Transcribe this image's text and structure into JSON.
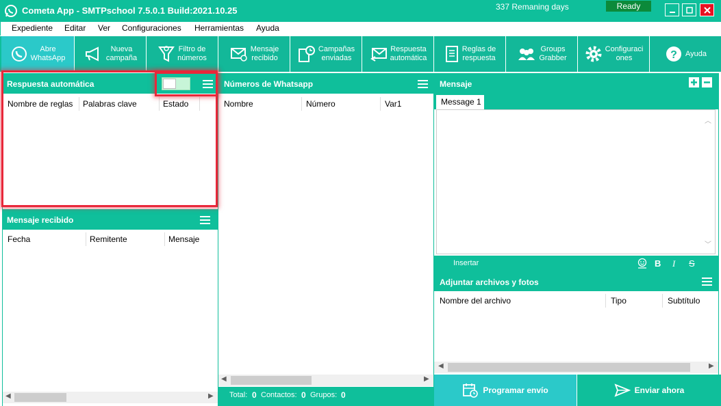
{
  "titlebar": {
    "title": "Cometa App - SMTPschool 7.5.0.1 Build:2021.10.25",
    "remaining": "337 Remaning days",
    "status": "Ready"
  },
  "menu": [
    "Expediente",
    "Editar",
    "Ver",
    "Configuraciones",
    "Herramientas",
    "Ayuda"
  ],
  "toolbar": [
    {
      "label": "Abre\nWhatsApp",
      "icon": "whatsapp-icon"
    },
    {
      "label": "Nueva\ncampaña",
      "icon": "megaphone-icon"
    },
    {
      "label": "Filtro de\nnúmeros",
      "icon": "funnel-icon"
    },
    {
      "label": "Mensaje\nrecibido",
      "icon": "envelope-check-icon"
    },
    {
      "label": "Campañas\nenviadas",
      "icon": "clock-list-icon"
    },
    {
      "label": "Respuesta\nautomática",
      "icon": "envelope-reply-icon"
    },
    {
      "label": "Reglas de\nrespuesta",
      "icon": "document-icon"
    },
    {
      "label": "Groups\nGrabber",
      "icon": "group-icon"
    },
    {
      "label": "Configuraci\nones",
      "icon": "gear-icon"
    },
    {
      "label": "Ayuda",
      "icon": "help-icon"
    }
  ],
  "auto_reply": {
    "title": "Respuesta automática",
    "toggle_on": true,
    "columns": [
      "Nombre de reglas",
      "Palabras clave",
      "Estado"
    ]
  },
  "received": {
    "title": "Mensaje recibido",
    "columns": [
      "Fecha",
      "Remitente",
      "Mensaje"
    ]
  },
  "numbers": {
    "title": "Números de Whatsapp",
    "columns": [
      "Nombre",
      "Número",
      "Var1"
    ],
    "footer": {
      "total_label": "Total:",
      "total": "0",
      "contacts_label": "Contactos:",
      "contacts": "0",
      "groups_label": "Grupos:",
      "groups": "0"
    }
  },
  "message": {
    "title": "Mensaje",
    "tab": "Message 1",
    "insert_label": "Insertar",
    "bold": "B",
    "italic": "I",
    "strike": "S"
  },
  "attachments": {
    "title": "Adjuntar archivos y fotos",
    "columns": [
      "Nombre del archivo",
      "Tipo",
      "Subtítulo"
    ]
  },
  "actions": {
    "schedule": "Programar envío",
    "send_now": "Enviar ahora"
  },
  "colors": {
    "accent": "#0fbf9b",
    "highlight": "#e8283a",
    "close": "#e81123",
    "ready": "#0c8a3a"
  }
}
